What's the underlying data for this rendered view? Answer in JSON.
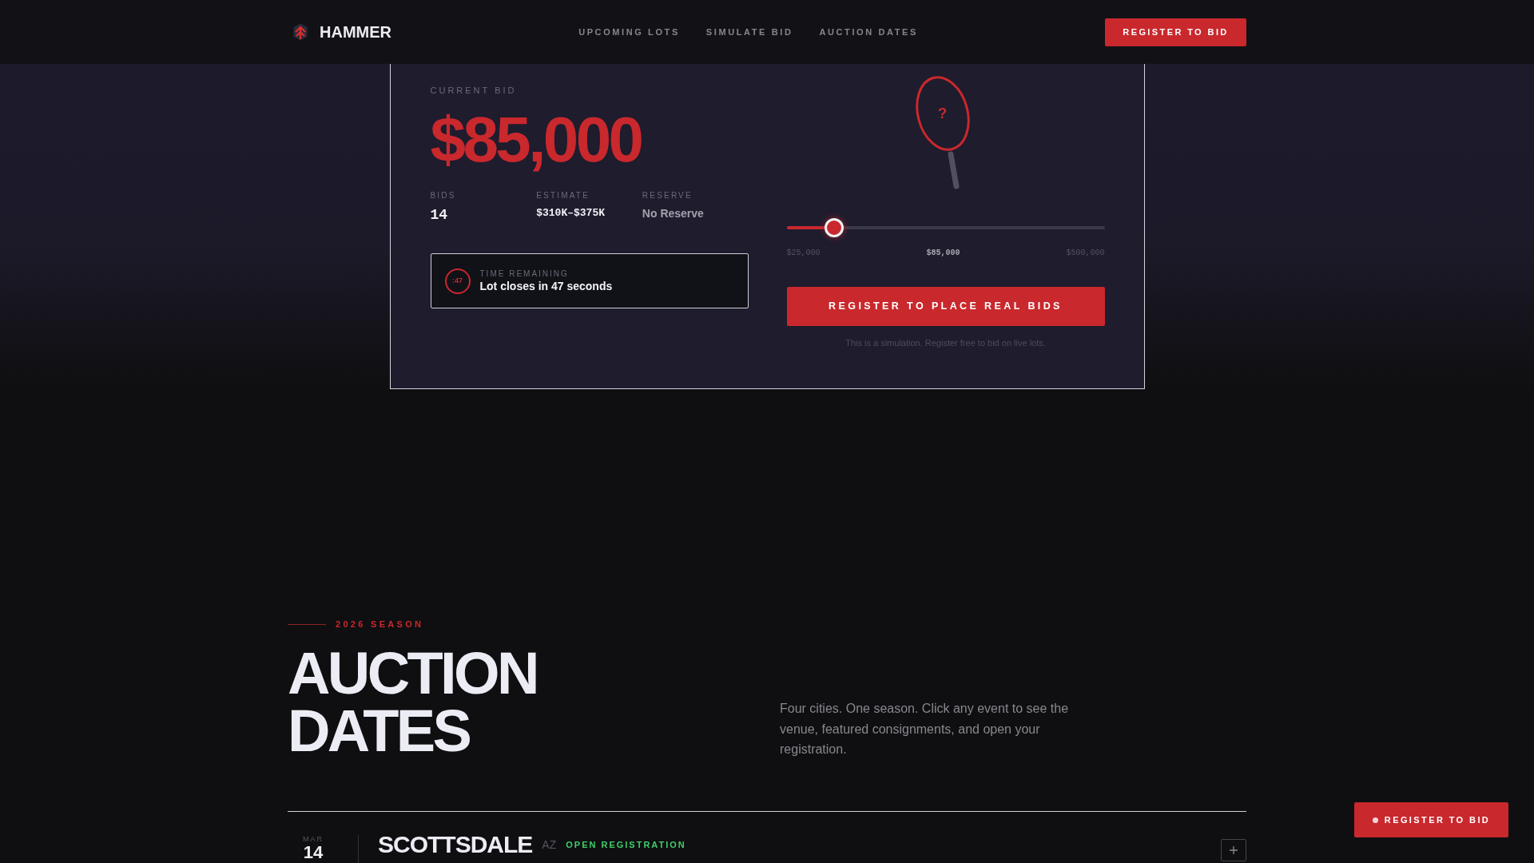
{
  "navbar": {
    "brand": "HAMMER",
    "links": [
      "UPCOMING LOTS",
      "SIMULATE BID",
      "AUCTION DATES"
    ],
    "button": "REGISTER TO BID"
  },
  "bid_card": {
    "label": "CURRENT BID",
    "current_bid": "$85,000",
    "stats": [
      {
        "kind": "count",
        "label": "BIDS",
        "value": "14"
      },
      {
        "kind": "money",
        "label": "ESTIMATE",
        "value": "$310K–$375K"
      },
      {
        "kind": "note",
        "label": "RESERVE",
        "value": "No Reserve"
      }
    ],
    "timer": {
      "badge": ":47",
      "label": "TIME REMAINING",
      "message": "Lot closes in 47 seconds"
    },
    "paddle_mark": "?",
    "slider": {
      "level": 0.126,
      "min": "$25,000",
      "value": "$85,000",
      "max": "$500,000"
    },
    "button": "REGISTER TO PLACE REAL BIDS",
    "note": "This is a simulation. Register free to bid on live lots."
  },
  "auction_dates": {
    "eyebrow": "2026 SEASON",
    "title": "AUCTION DATES",
    "intro": "Four cities. One season. Click any event to see the venue, featured consignments, and open your registration.",
    "events": [
      {
        "month": "MAR",
        "day": "14",
        "city": "SCOTTSDALE",
        "state": "AZ",
        "status": "OPEN REGISTRATION",
        "expanded": false
      }
    ]
  },
  "floating_button": "REGISTER TO BID"
}
